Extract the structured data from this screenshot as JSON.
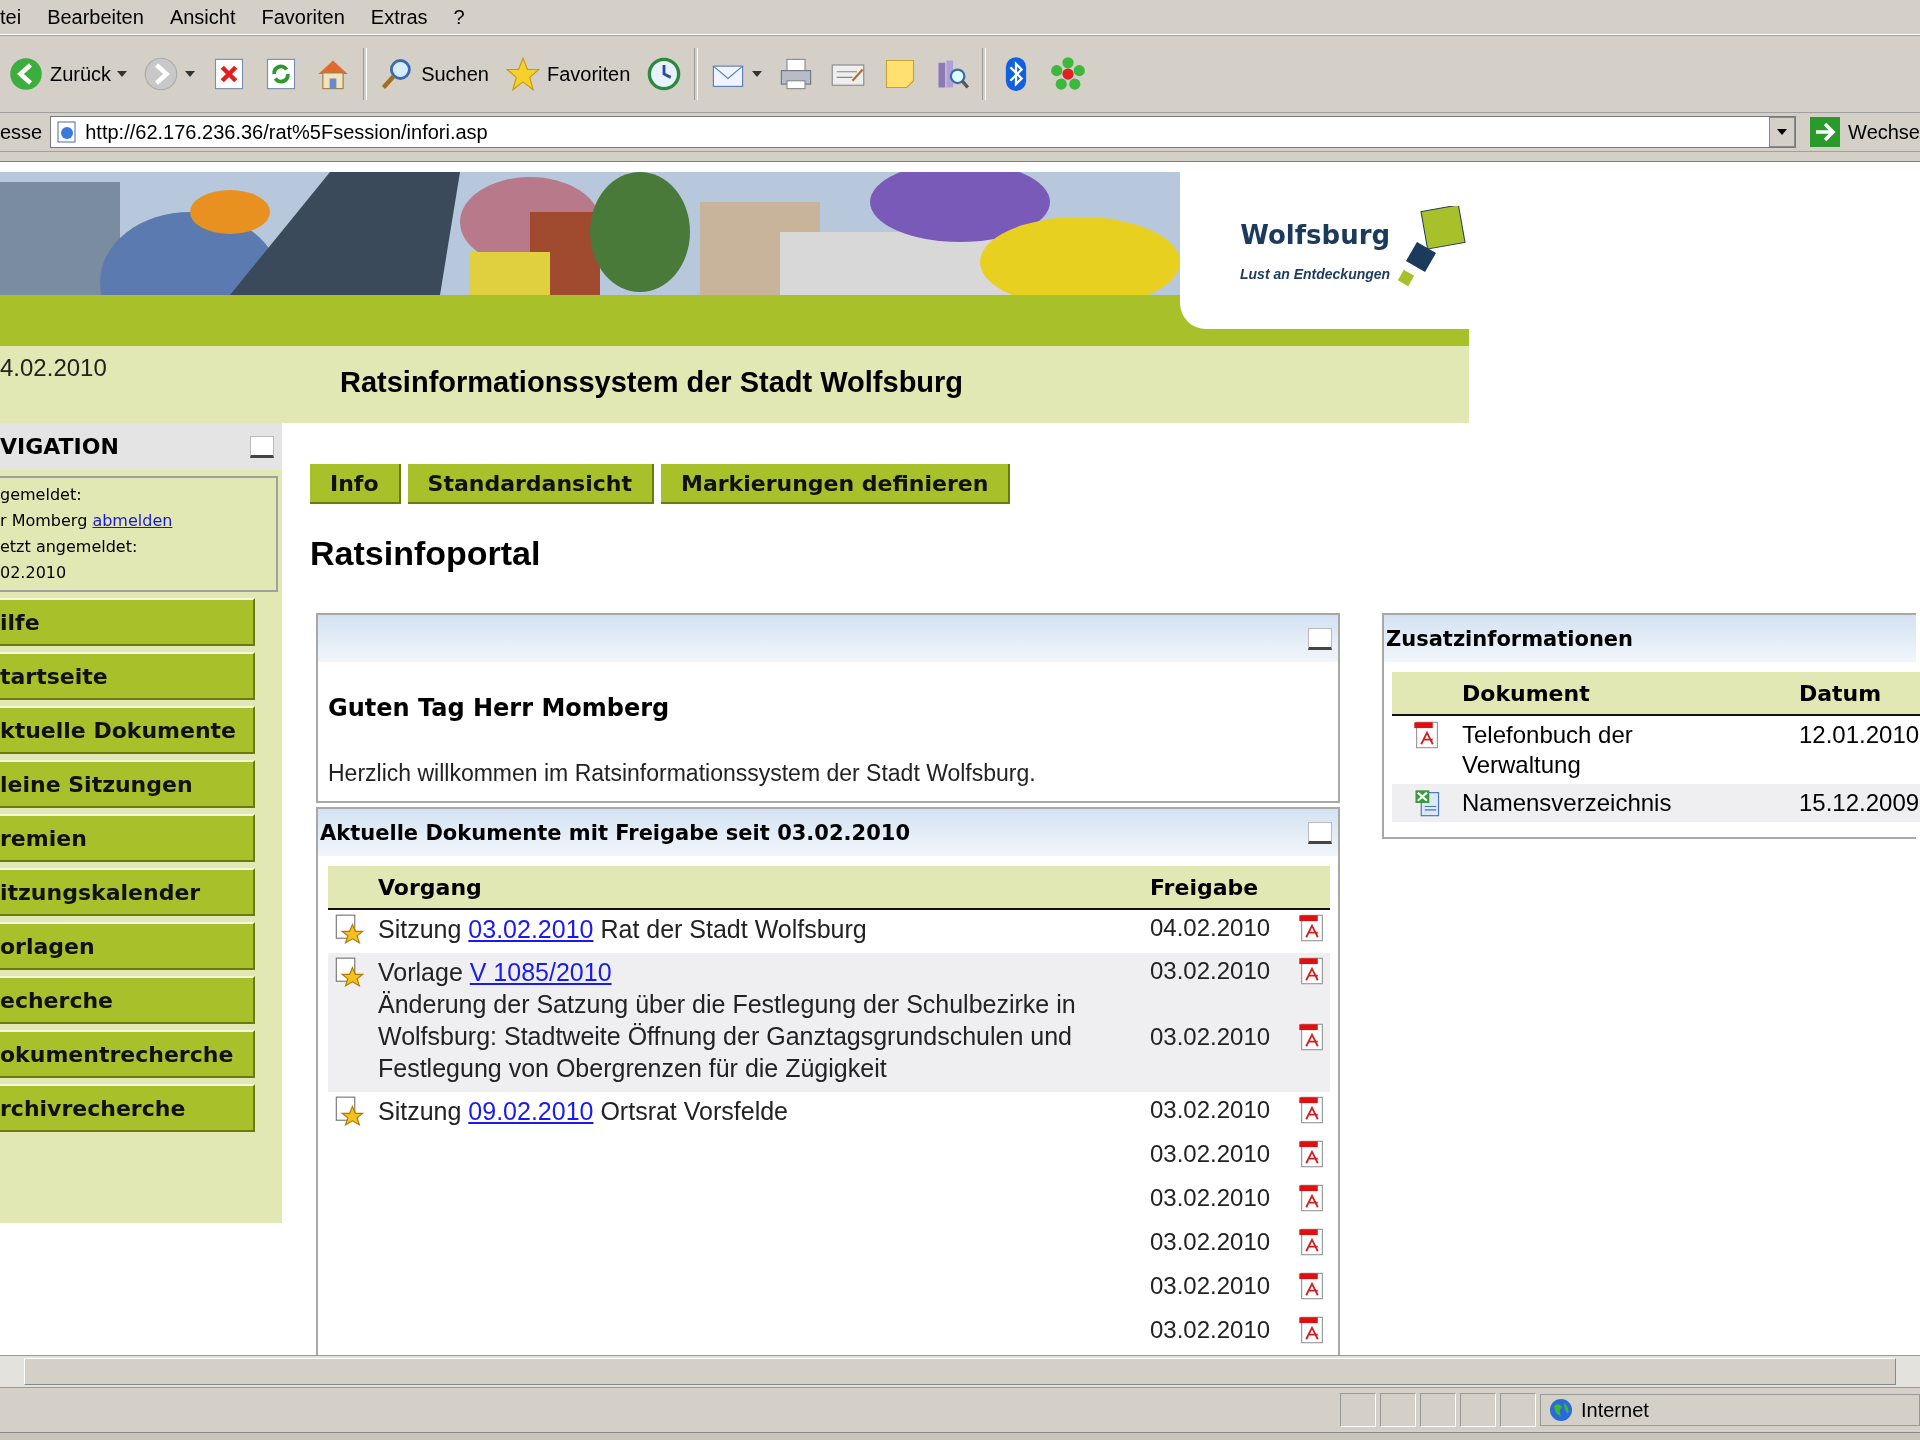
{
  "menu": [
    "tei",
    "Bearbeiten",
    "Ansicht",
    "Favoriten",
    "Extras",
    "?"
  ],
  "toolbar": [
    {
      "kind": "back",
      "label": "Zurück"
    },
    {
      "kind": "forward"
    },
    {
      "kind": "stop"
    },
    {
      "kind": "refresh"
    },
    {
      "kind": "home"
    },
    {
      "kind": "search",
      "label": "Suchen"
    },
    {
      "kind": "favorites",
      "label": "Favoriten"
    },
    {
      "kind": "history"
    },
    {
      "kind": "mail"
    },
    {
      "kind": "print"
    },
    {
      "kind": "edit"
    },
    {
      "kind": "note"
    },
    {
      "kind": "research"
    },
    {
      "kind": "bluetooth"
    },
    {
      "kind": "flower"
    }
  ],
  "address": {
    "label": "esse",
    "url": "http://62.176.236.36/rat%5Fsession/infori.asp",
    "go": "Wechse"
  },
  "banner": {
    "logo_title": "Wolfsburg",
    "logo_slogan": "Lust an Entdeckungen"
  },
  "date": "4.02.2010",
  "site_title": "Ratsinformationssystem der Stadt Wolfsburg",
  "navigation": {
    "title": "VIGATION",
    "login": [
      {
        "text": "gemeldet:"
      },
      {
        "text": "r Momberg",
        "link": "abmelden"
      },
      {
        "text": "etzt angemeldet:"
      },
      {
        "text": "02.2010"
      }
    ],
    "items": [
      "ilfe",
      "tartseite",
      "ktuelle Dokumente",
      "leine Sitzungen",
      "remien",
      "itzungskalender",
      "orlagen",
      "echerche",
      "okumentrecherche",
      "rchivrecherche"
    ]
  },
  "tabs": [
    "Info",
    "Standardansicht",
    "Markierungen definieren"
  ],
  "page_title": "Ratsinfoportal",
  "welcome": {
    "heading": "Guten Tag Herr Momberg",
    "text": "Herzlich willkommen im Ratsinformationssystem der Stadt Wolfsburg."
  },
  "documents": {
    "title": "Aktuelle Dokumente mit Freigabe seit 03.02.2010",
    "columns": [
      "Vorgang",
      "Freigabe"
    ],
    "rows": [
      {
        "prefix": "Sitzung",
        "link": "03.02.2010",
        "suffix": "Rat der Stadt Wolfsburg",
        "dates": [
          "04.02.2010"
        ]
      },
      {
        "prefix": "Vorlage",
        "link": "V 1085/2010",
        "description": "Änderung der Satzung über die Festlegung der Schulbezirke in Wolfsburg: Stadtweite Öffnung der Ganztagsgrundschulen und Festlegung von Obergrenzen für die Zügigkeit",
        "dates": [
          "03.02.2010",
          "03.02.2010"
        ]
      },
      {
        "prefix": "Sitzung",
        "link": "09.02.2010",
        "suffix": "Ortsrat Vorsfelde",
        "dates": [
          "03.02.2010",
          "03.02.2010",
          "03.02.2010",
          "03.02.2010",
          "03.02.2010",
          "03.02.2010"
        ]
      }
    ]
  },
  "extra": {
    "title": "Zusatzinformationen",
    "columns": [
      "Dokument",
      "Datum"
    ],
    "rows": [
      {
        "kind": "pdf",
        "name": "Telefonbuch der Verwaltung",
        "date": "12.01.2010"
      },
      {
        "kind": "xls",
        "name": "Namensverzeichnis",
        "date": "15.12.2009"
      }
    ]
  },
  "status": {
    "zone": "Internet"
  }
}
